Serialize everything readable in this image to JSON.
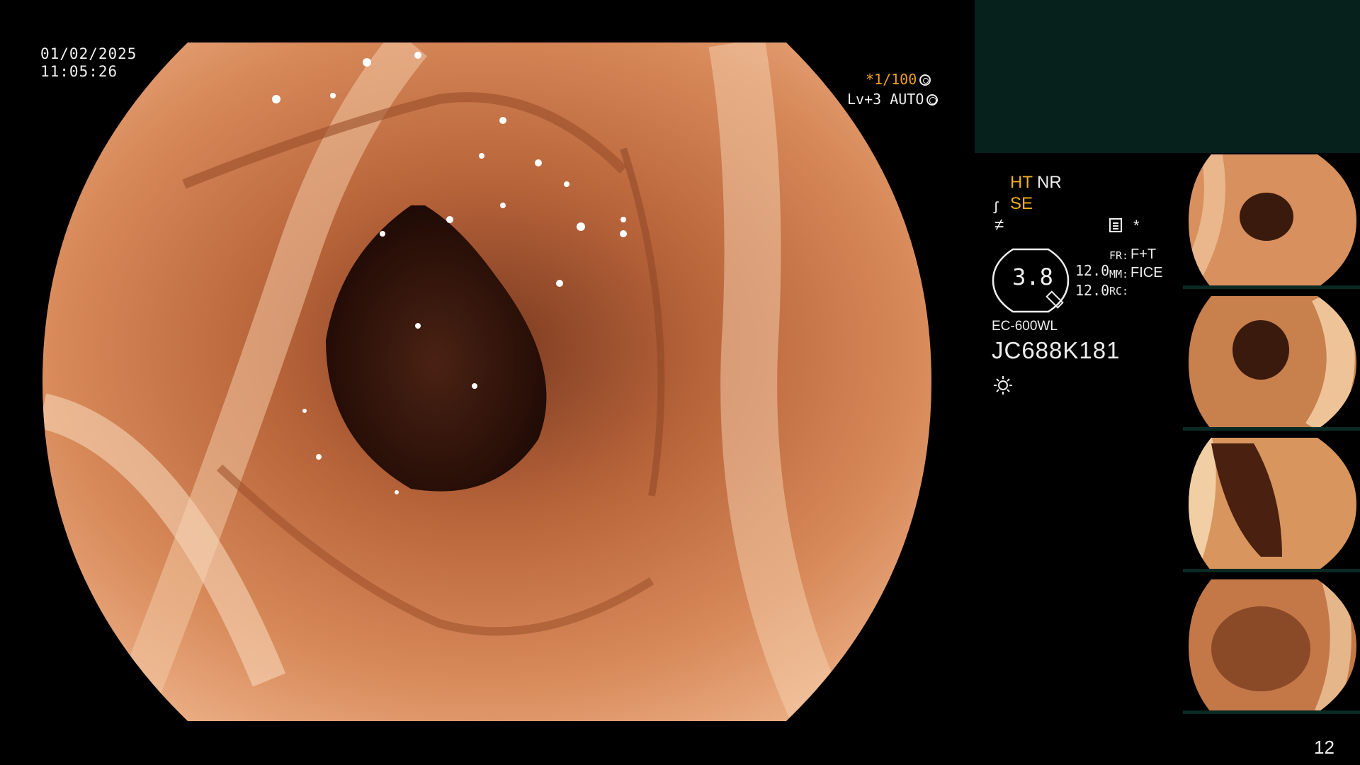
{
  "overlay": {
    "date": "01/02/2025",
    "time": "11:05:26",
    "shutter": "*1/100",
    "level": "Lv+3 AUTO"
  },
  "info_panel": {
    "ht": "HT",
    "nr": "NR",
    "se": "SE",
    "star": "*",
    "scale_value": "3.8",
    "value_1": "12.0",
    "value_2": "12.0",
    "fr_label": "FR:",
    "fr_value": "F+T",
    "mm_label": "MM:",
    "mm_value": "FICE",
    "rc_label": "RC:",
    "scope_model": "EC-600WL",
    "scope_serial": "JC688K181"
  },
  "thumbnails": [
    {
      "name": "thumbnail-1"
    },
    {
      "name": "thumbnail-2"
    },
    {
      "name": "thumbnail-3"
    },
    {
      "name": "thumbnail-4"
    }
  ],
  "icons": [
    "shutter-icon",
    "auto-icon",
    "se-icon",
    "f-icon",
    "menu-icon",
    "light-icon"
  ],
  "colors": {
    "accent": "#f0b020",
    "top_panel": "#06201c",
    "background": "#000000"
  },
  "page_number": "12"
}
